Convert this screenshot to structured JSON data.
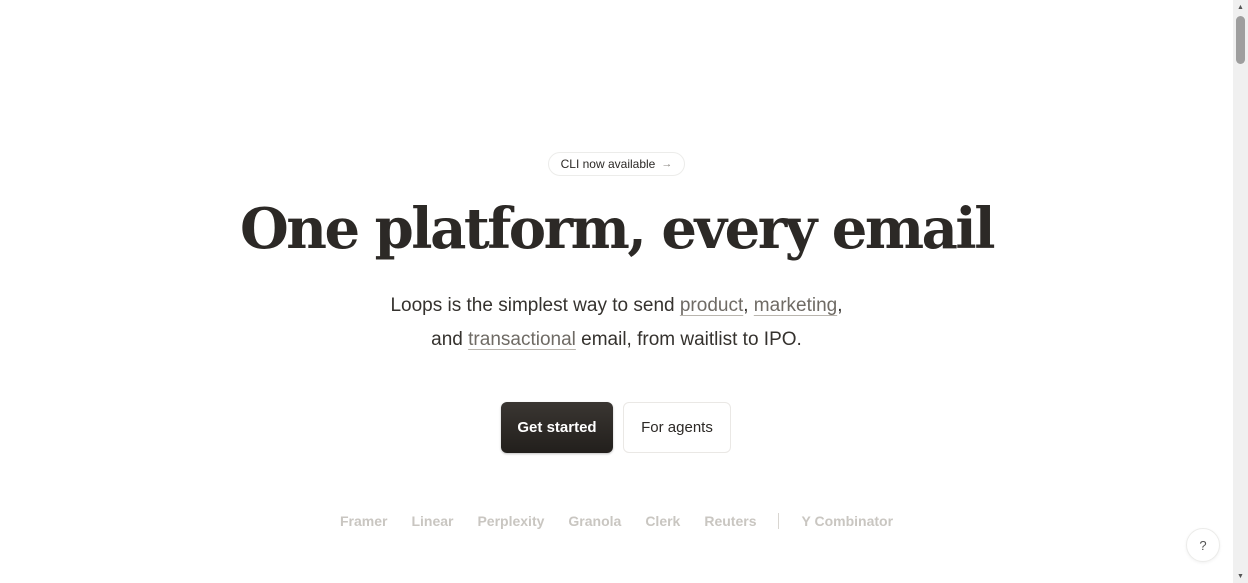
{
  "announcement": {
    "label": "CLI now available",
    "arrow": "→"
  },
  "hero": {
    "headline": "One platform, every email",
    "subtitle": {
      "part1": "Loops is the simplest way to send ",
      "link_product": "product",
      "comma1": ", ",
      "link_marketing": "marketing",
      "comma2": ",",
      "part2": "and ",
      "link_transactional": "transactional",
      "part3": " email, from waitlist to IPO."
    }
  },
  "cta": {
    "primary_label": "Get started",
    "secondary_label": "For agents"
  },
  "logos": [
    "Framer",
    "Linear",
    "Perplexity",
    "Granola",
    "Clerk",
    "Reuters"
  ],
  "logos_extra": "Y Combinator",
  "help": {
    "label": "?"
  },
  "scrollbar": {
    "up": "▲",
    "down": "▼"
  },
  "colors": {
    "text": "#2c2926",
    "primary_button": "#2c2926",
    "logo_gray": "#c9c6c1",
    "link": "#6f6b65"
  }
}
